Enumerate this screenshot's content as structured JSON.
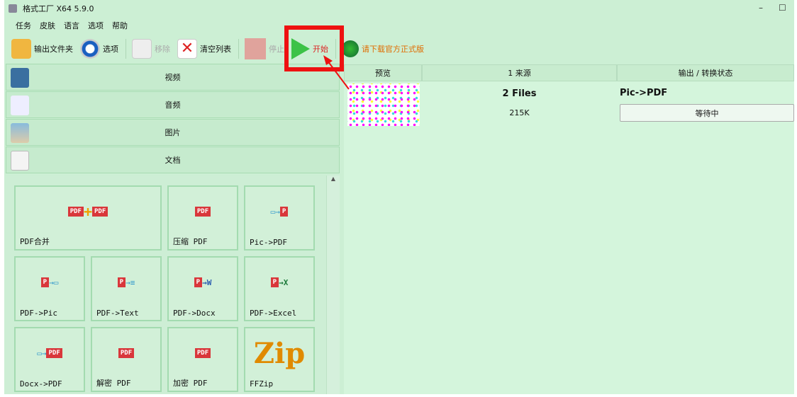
{
  "window": {
    "title": "格式工厂 X64 5.9.0",
    "minimize": "–",
    "maximize": "☐"
  },
  "menu": [
    "任务",
    "皮肤",
    "语言",
    "选项",
    "帮助"
  ],
  "toolbar": {
    "output_folder": "输出文件夹",
    "options": "选项",
    "remove": "移除",
    "clear_list": "清空列表",
    "stop": "停止",
    "start": "开始",
    "download": "请下载官方正式版"
  },
  "categories": [
    "视频",
    "音频",
    "图片",
    "文档"
  ],
  "tools": [
    "PDF合并",
    "压缩 PDF",
    "Pic->PDF",
    "PDF->Pic",
    "PDF->Text",
    "PDF->Docx",
    "PDF->Excel",
    "Docx->PDF",
    "解密 PDF",
    "加密 PDF",
    "FFZip"
  ],
  "list": {
    "headers": [
      "预览",
      "1 来源",
      "输出 / 转换状态"
    ],
    "rows": [
      {
        "source": "2 Files",
        "size": "215K",
        "output": "Pic->PDF",
        "status": "等待中"
      }
    ]
  },
  "colors": {
    "highlight": "#ee1111",
    "start": "#3cc247",
    "pdf": "#d9373b"
  }
}
